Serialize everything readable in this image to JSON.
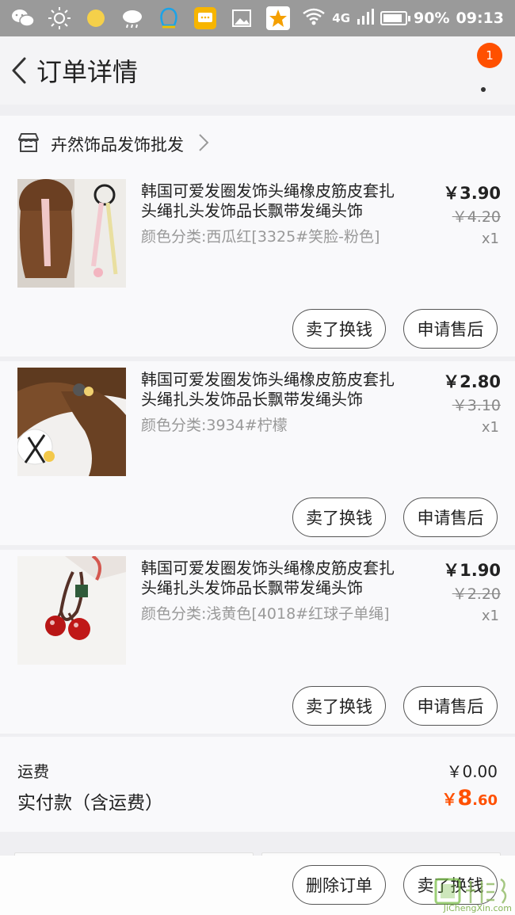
{
  "status_bar": {
    "network": "4G",
    "battery": "90%",
    "battery_level": 0.9,
    "time": "09:13",
    "icons": [
      "wechat-icon",
      "brightness-icon",
      "moon-icon",
      "weather-icon",
      "qq-icon",
      "message-icon",
      "gallery-icon",
      "taobao-icon"
    ]
  },
  "header": {
    "title": "订单详情",
    "badge": "1"
  },
  "shop": {
    "name": "卉然饰品发饰批发"
  },
  "items": [
    {
      "name": "韩国可爱发圈发饰头绳橡皮筋皮套扎头绳扎头发饰品长飘带发绳头饰",
      "variant": "颜色分类:西瓜红[3325#笑脸-粉色]",
      "price": "￥3.90",
      "original_price": "￥4.20",
      "qty": "x1",
      "sell_label": "卖了换钱",
      "aftersale_label": "申请售后"
    },
    {
      "name": "韩国可爱发圈发饰头绳橡皮筋皮套扎头绳扎头发饰品长飘带发绳头饰",
      "variant": "颜色分类:3934#柠檬",
      "price": "￥2.80",
      "original_price": "￥3.10",
      "qty": "x1",
      "sell_label": "卖了换钱",
      "aftersale_label": "申请售后"
    },
    {
      "name": "韩国可爱发圈发饰头绳橡皮筋皮套扎头绳扎头发饰品长飘带发绳头饰",
      "variant": "颜色分类:浅黄色[4018#红球子单绳]",
      "price": "￥1.90",
      "original_price": "￥2.20",
      "qty": "x1",
      "sell_label": "卖了换钱",
      "aftersale_label": "申请售后"
    }
  ],
  "summary": {
    "shipping_label": "运费",
    "shipping_value": "￥0.00",
    "paid_label": "实付款（含运费）",
    "paid_currency": "￥",
    "paid_integer": "8",
    "paid_decimal": ".60"
  },
  "bottom": {
    "delete_label": "删除订单",
    "sell_label": "卖了换钱"
  },
  "watermark": "JiChengXin.com",
  "colors": {
    "accent": "#ff5000",
    "status_bar": "#9a9a9a",
    "background": "#efeff2"
  }
}
